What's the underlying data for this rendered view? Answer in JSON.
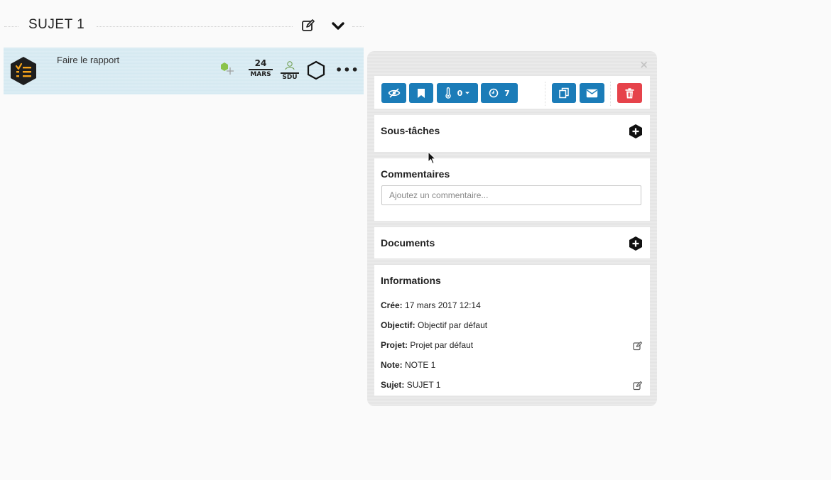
{
  "subject": {
    "title": "SUJET 1"
  },
  "task": {
    "title": "Faire le rapport",
    "due_day": "24",
    "due_month": "MARS",
    "assignee_initials": "SDU",
    "more_label": "•••"
  },
  "panel": {
    "close_label": "×",
    "toolbar": {
      "temperature_count": "0",
      "time_count": "7"
    },
    "subtasks": {
      "title": "Sous-tâches"
    },
    "comments": {
      "title": "Commentaires",
      "placeholder": "Ajoutez un commentaire..."
    },
    "documents": {
      "title": "Documents"
    },
    "informations": {
      "title": "Informations",
      "rows": [
        {
          "label": "Crée:",
          "value": "17 mars 2017 12:14"
        },
        {
          "label": "Objectif:",
          "value": "Objectif par défaut"
        },
        {
          "label": "Projet:",
          "value": "Projet par défaut"
        },
        {
          "label": "Note:",
          "value": "NOTE 1"
        },
        {
          "label": "Sujet:",
          "value": "SUJET 1"
        }
      ]
    }
  },
  "colors": {
    "accent_blue": "#1b7cb8",
    "danger_red": "#e6434b",
    "task_row_bg": "#d5e9f1",
    "logo_orange": "#f5a31a",
    "tag_green": "#8bc34a"
  },
  "icons": {
    "header": [
      "edit-icon",
      "chevron-down-icon"
    ],
    "toolbar": [
      "eye-slash-icon",
      "bookmark-icon",
      "thermometer-icon",
      "clock-icon",
      "copy-icon",
      "envelope-icon",
      "trash-icon"
    ]
  }
}
